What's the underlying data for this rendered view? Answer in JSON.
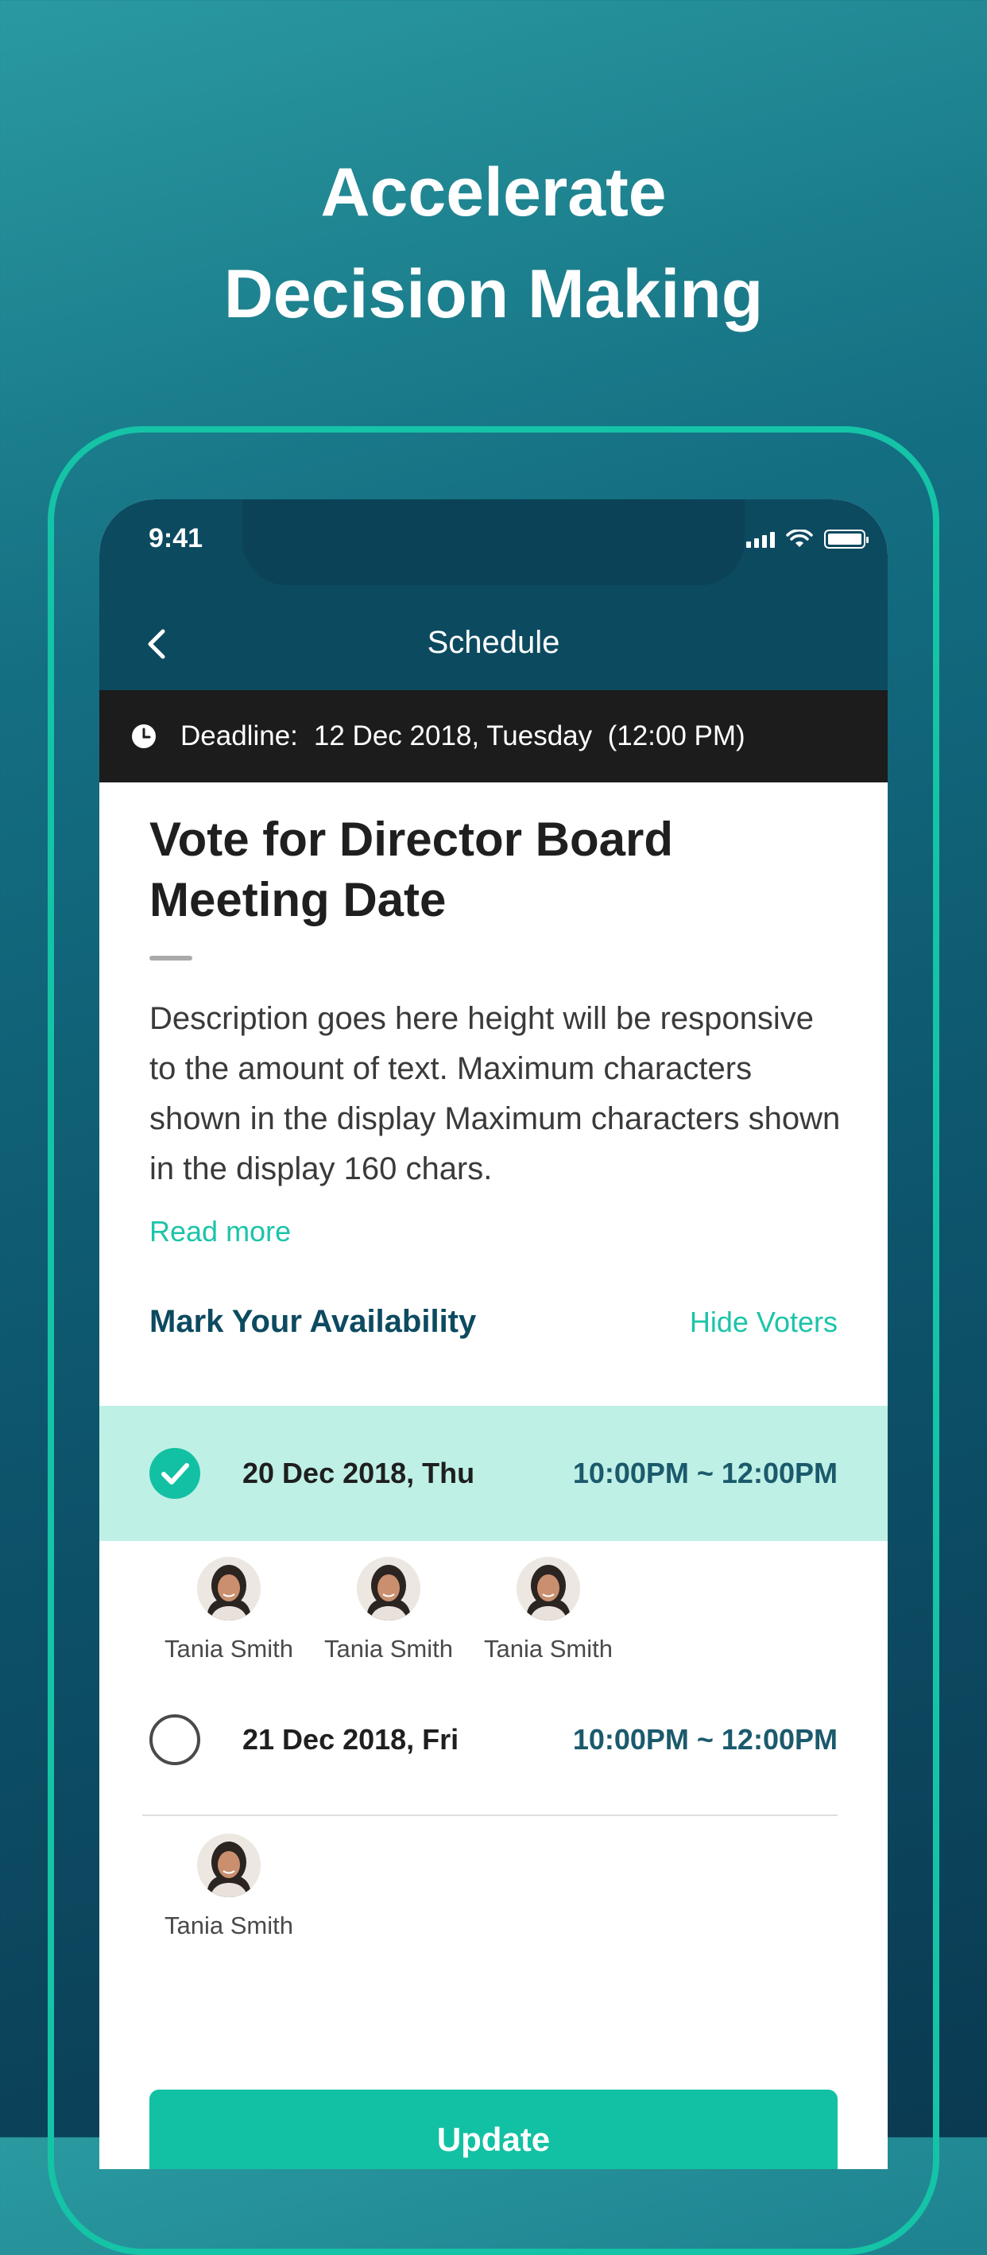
{
  "headline": {
    "line1": "Accelerate",
    "line2": "Decision Making"
  },
  "status_bar": {
    "time": "9:41"
  },
  "nav": {
    "title": "Schedule",
    "back_icon": "chevron-left-icon"
  },
  "deadline": {
    "label": "Deadline:",
    "value": "12 Dec 2018, Tuesday  (12:00 PM)",
    "icon": "clock-icon"
  },
  "poll": {
    "title": "Vote for Director Board Meeting Date",
    "description": "Description goes here height will be responsive to the amount of text. Maximum characters shown in the display  Maximum characters shown in the display 160 chars.",
    "read_more": "Read more"
  },
  "availability": {
    "label": "Mark Your Availability",
    "hide_voters": "Hide Voters",
    "options": [
      {
        "date": "20 Dec 2018, Thu",
        "time": "10:00PM ~ 12:00PM",
        "selected": true,
        "voters": [
          "Tania Smith",
          "Tania Smith",
          "Tania Smith"
        ]
      },
      {
        "date": "21 Dec 2018, Fri",
        "time": "10:00PM ~ 12:00PM",
        "selected": false,
        "voters": [
          "Tania Smith"
        ]
      }
    ]
  },
  "actions": {
    "update": "Update"
  },
  "colors": {
    "accent": "#12c1a3",
    "nav_bg": "#0c4a60",
    "selected_bg": "#bff0e6",
    "frame": "#15c3a6"
  }
}
